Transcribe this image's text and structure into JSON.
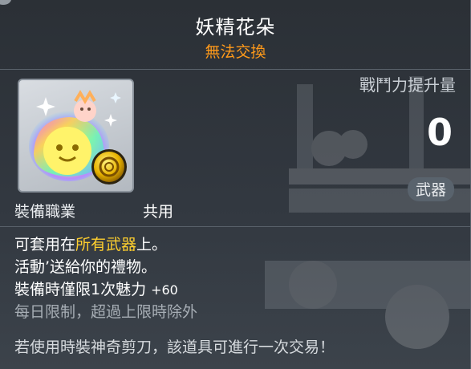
{
  "item": {
    "name": "妖精花朵",
    "trade_status": "無法交換",
    "icon": "fairy-flower-icon"
  },
  "stats": {
    "power_label": "戰鬥力提升量",
    "power_value": "0",
    "type_badge": "武器"
  },
  "job": {
    "label": "裝備職業",
    "value": "共用"
  },
  "description": {
    "line1_prefix": "可套用在",
    "line1_highlight": "所有武器",
    "line1_suffix": "上。",
    "line2": "活動’送給你的禮物。",
    "line3_text": "裝備時僅限1次魅力",
    "line3_bonus": "+60",
    "line4": "每日限制，超過上限時除外",
    "line5": "若使用時裝神奇剪刀，該道具可進行一次交易！"
  },
  "colors": {
    "trade_status": "#ff9a1a",
    "highlight": "#ffcf2e",
    "dim_text": "#a7aeb5"
  }
}
